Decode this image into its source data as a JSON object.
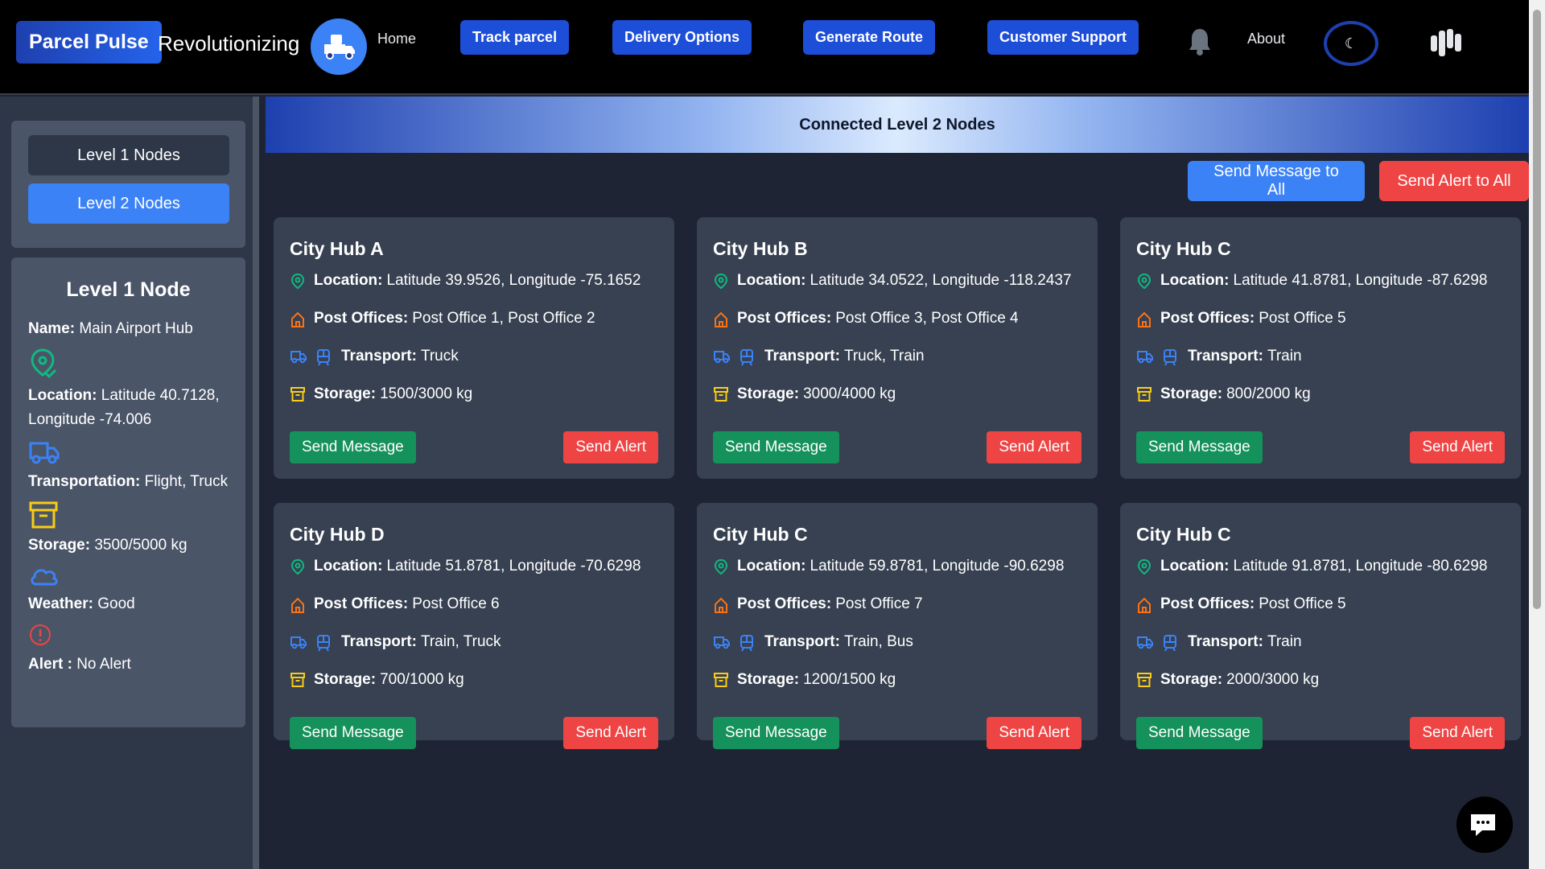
{
  "header": {
    "brand": "Parcel Pulse",
    "tagline": "Revolutionizing",
    "nav": {
      "home": "Home",
      "track": "Track parcel",
      "delivery": "Delivery Options",
      "route": "Generate Route",
      "support": "Customer Support",
      "about": "About"
    },
    "theme_icon": "☾"
  },
  "sidebar": {
    "level1_label": "Level 1 Nodes",
    "level2_label": "Level 2 Nodes",
    "node": {
      "title": "Level 1 Node",
      "name_label": "Name:",
      "name_value": "Main Airport Hub",
      "location_label": "Location:",
      "location_value": "Latitude 40.7128, Longitude -74.006",
      "transport_label": "Transportation:",
      "transport_value": "Flight, Truck",
      "storage_label": "Storage:",
      "storage_value": "3500/5000 kg",
      "weather_label": "Weather:",
      "weather_value": "Good",
      "alert_label": "Alert :",
      "alert_value": "No Alert"
    }
  },
  "main": {
    "banner": "Connected Level 2 Nodes",
    "send_all_message": "Send Message to All",
    "send_all_alert": "Send Alert to All",
    "labels": {
      "location": "Location:",
      "post_offices": "Post Offices:",
      "transport": "Transport:",
      "storage": "Storage:",
      "send_message": "Send Message",
      "send_alert": "Send Alert"
    },
    "cards": [
      {
        "title": "City Hub A",
        "location": "Latitude 39.9526, Longitude -75.1652",
        "post_offices": "Post Office 1, Post Office 2",
        "transport": "Truck",
        "storage": "1500/3000 kg"
      },
      {
        "title": "City Hub B",
        "location": "Latitude 34.0522, Longitude -118.2437",
        "post_offices": "Post Office 3, Post Office 4",
        "transport": "Truck, Train",
        "storage": "3000/4000 kg"
      },
      {
        "title": "City Hub C",
        "location": "Latitude 41.8781, Longitude -87.6298",
        "post_offices": "Post Office 5",
        "transport": "Train",
        "storage": "800/2000 kg"
      },
      {
        "title": "City Hub D",
        "location": "Latitude 51.8781, Longitude -70.6298",
        "post_offices": "Post Office 6",
        "transport": "Train, Truck",
        "storage": "700/1000 kg"
      },
      {
        "title": "City Hub C",
        "location": "Latitude 59.8781, Longitude -90.6298",
        "post_offices": "Post Office 7",
        "transport": "Train, Bus",
        "storage": "1200/1500 kg"
      },
      {
        "title": "City Hub C",
        "location": "Latitude 91.8781, Longitude -80.6298",
        "post_offices": "Post Office 5",
        "transport": "Train",
        "storage": "2000/3000 kg"
      }
    ]
  },
  "colors": {
    "accent_blue": "#3b82f6",
    "nav_button": "#1d4ed8",
    "message_green": "#15915b",
    "alert_red": "#ef4444",
    "location_icon": "#10b981",
    "post_office_icon": "#f97316",
    "transport_icon": "#3b82f6",
    "storage_icon": "#facc15"
  },
  "icons": [
    "truck-logo-icon",
    "bell-icon",
    "moon-icon",
    "grid-apps-icon",
    "map-pin-icon",
    "home-icon",
    "truck-icon",
    "train-icon",
    "archive-box-icon",
    "cloud-icon",
    "alert-circle-icon",
    "chat-icon"
  ]
}
